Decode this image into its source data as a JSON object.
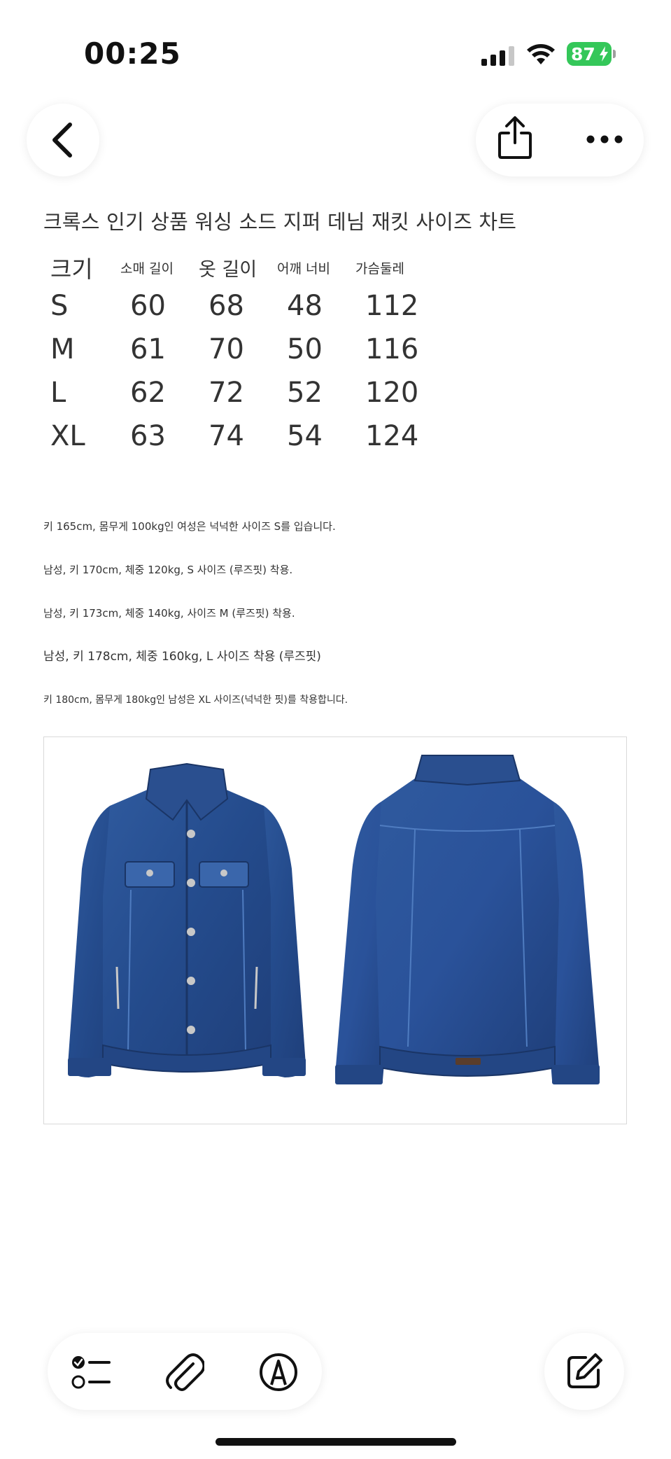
{
  "status_bar": {
    "time": "00:25",
    "battery": "87"
  },
  "nav": {
    "back_icon": "chevron-left-icon",
    "share_icon": "share-icon",
    "more_icon": "ellipsis-icon"
  },
  "document": {
    "title": "크록스 인기 상품 워싱 소드 지퍼 데님 재킷 사이즈 차트",
    "size_table": {
      "headers": [
        "크기",
        "소매 길이",
        "옷 길이",
        "어깨 너비",
        "가슴둘레"
      ],
      "rows": [
        [
          "S",
          "60",
          "68",
          "48",
          "112"
        ],
        [
          "M",
          "61",
          "70",
          "50",
          "116"
        ],
        [
          "L",
          "62",
          "72",
          "52",
          "120"
        ],
        [
          "XL",
          "63",
          "74",
          "54",
          "124"
        ]
      ]
    },
    "notes": [
      "키 165cm, 몸무게 100kg인 여성은 넉넉한 사이즈 S를 입습니다.",
      "남성, 키 170cm, 체중 120kg, S 사이즈 (루즈핏) 착용.",
      "남성, 키 173cm, 체중 140kg, 사이즈 M (루즈핏) 착용.",
      "남성, 키 178cm, 체중 160kg, L 사이즈 착용 (루즈핏)",
      "키 180cm, 몸무게 180kg인 남성은 XL 사이즈(넉넉한 핏)를 착용합니다."
    ]
  },
  "colors": {
    "denim_dark": "#1f3f7a",
    "denim_mid": "#2f5a9e",
    "denim_light": "#4f7cc0",
    "battery_green": "#34c759"
  },
  "toolbar": {
    "icons": [
      "checklist-icon",
      "paperclip-icon",
      "markup-pen-icon",
      "compose-icon"
    ]
  }
}
